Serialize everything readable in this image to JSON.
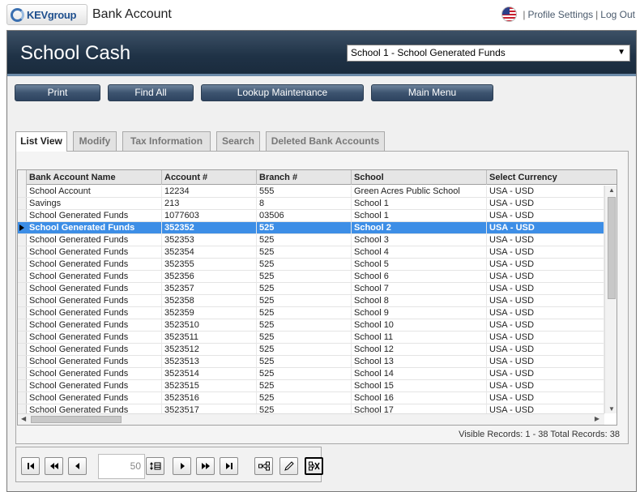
{
  "top": {
    "logo_text": "KEVgroup",
    "app_title": "Bank Account",
    "profile_link": "Profile Settings",
    "logout_link": "Log Out",
    "separator": "|"
  },
  "header": {
    "title": "School Cash",
    "school_select": "School 1 - School Generated Funds"
  },
  "toolbar": {
    "print": "Print",
    "find_all": "Find All",
    "lookup": "Lookup Maintenance",
    "main_menu": "Main Menu"
  },
  "tabs": [
    {
      "label": "List View",
      "active": true
    },
    {
      "label": "Modify",
      "active": false
    },
    {
      "label": "Tax Information",
      "active": false
    },
    {
      "label": "Search",
      "active": false
    },
    {
      "label": "Deleted Bank Accounts",
      "active": false
    }
  ],
  "grid": {
    "columns": [
      "Bank Account Name",
      "Account #",
      "Branch #",
      "School",
      "Select Currency"
    ],
    "selected_index": 3,
    "rows": [
      [
        "School Account",
        "12234",
        "555",
        "Green Acres Public School",
        "USA - USD"
      ],
      [
        "Savings",
        "213",
        "8",
        "School 1",
        "USA - USD"
      ],
      [
        "School Generated Funds",
        "1077603",
        "03506",
        "School 1",
        "USA - USD"
      ],
      [
        "School Generated Funds",
        "352352",
        "525",
        "School 2",
        "USA - USD"
      ],
      [
        "School Generated Funds",
        "352353",
        "525",
        "School 3",
        "USA - USD"
      ],
      [
        "School Generated Funds",
        "352354",
        "525",
        "School 4",
        "USA - USD"
      ],
      [
        "School Generated Funds",
        "352355",
        "525",
        "School 5",
        "USA - USD"
      ],
      [
        "School Generated Funds",
        "352356",
        "525",
        "School 6",
        "USA - USD"
      ],
      [
        "School Generated Funds",
        "352357",
        "525",
        "School 7",
        "USA - USD"
      ],
      [
        "School Generated Funds",
        "352358",
        "525",
        "School 8",
        "USA - USD"
      ],
      [
        "School Generated Funds",
        "352359",
        "525",
        "School 9",
        "USA - USD"
      ],
      [
        "School Generated Funds",
        "3523510",
        "525",
        "School 10",
        "USA - USD"
      ],
      [
        "School Generated Funds",
        "3523511",
        "525",
        "School 11",
        "USA - USD"
      ],
      [
        "School Generated Funds",
        "3523512",
        "525",
        "School 12",
        "USA - USD"
      ],
      [
        "School Generated Funds",
        "3523513",
        "525",
        "School 13",
        "USA - USD"
      ],
      [
        "School Generated Funds",
        "3523514",
        "525",
        "School 14",
        "USA - USD"
      ],
      [
        "School Generated Funds",
        "3523515",
        "525",
        "School 15",
        "USA - USD"
      ],
      [
        "School Generated Funds",
        "3523516",
        "525",
        "School 16",
        "USA - USD"
      ],
      [
        "School Generated Funds",
        "3523517",
        "525",
        "School 17",
        "USA - USD"
      ]
    ]
  },
  "status": "Visible Records: 1 - 38 Total Records: 38",
  "nav": {
    "page_size": "50",
    "icons": [
      "first-page-icon",
      "previous-page-icon",
      "previous-record-icon",
      "rows-per-page-icon",
      "next-record-icon",
      "next-page-icon",
      "last-page-icon",
      "column-chooser-icon",
      "edit-icon",
      "clear-filter-icon"
    ]
  }
}
